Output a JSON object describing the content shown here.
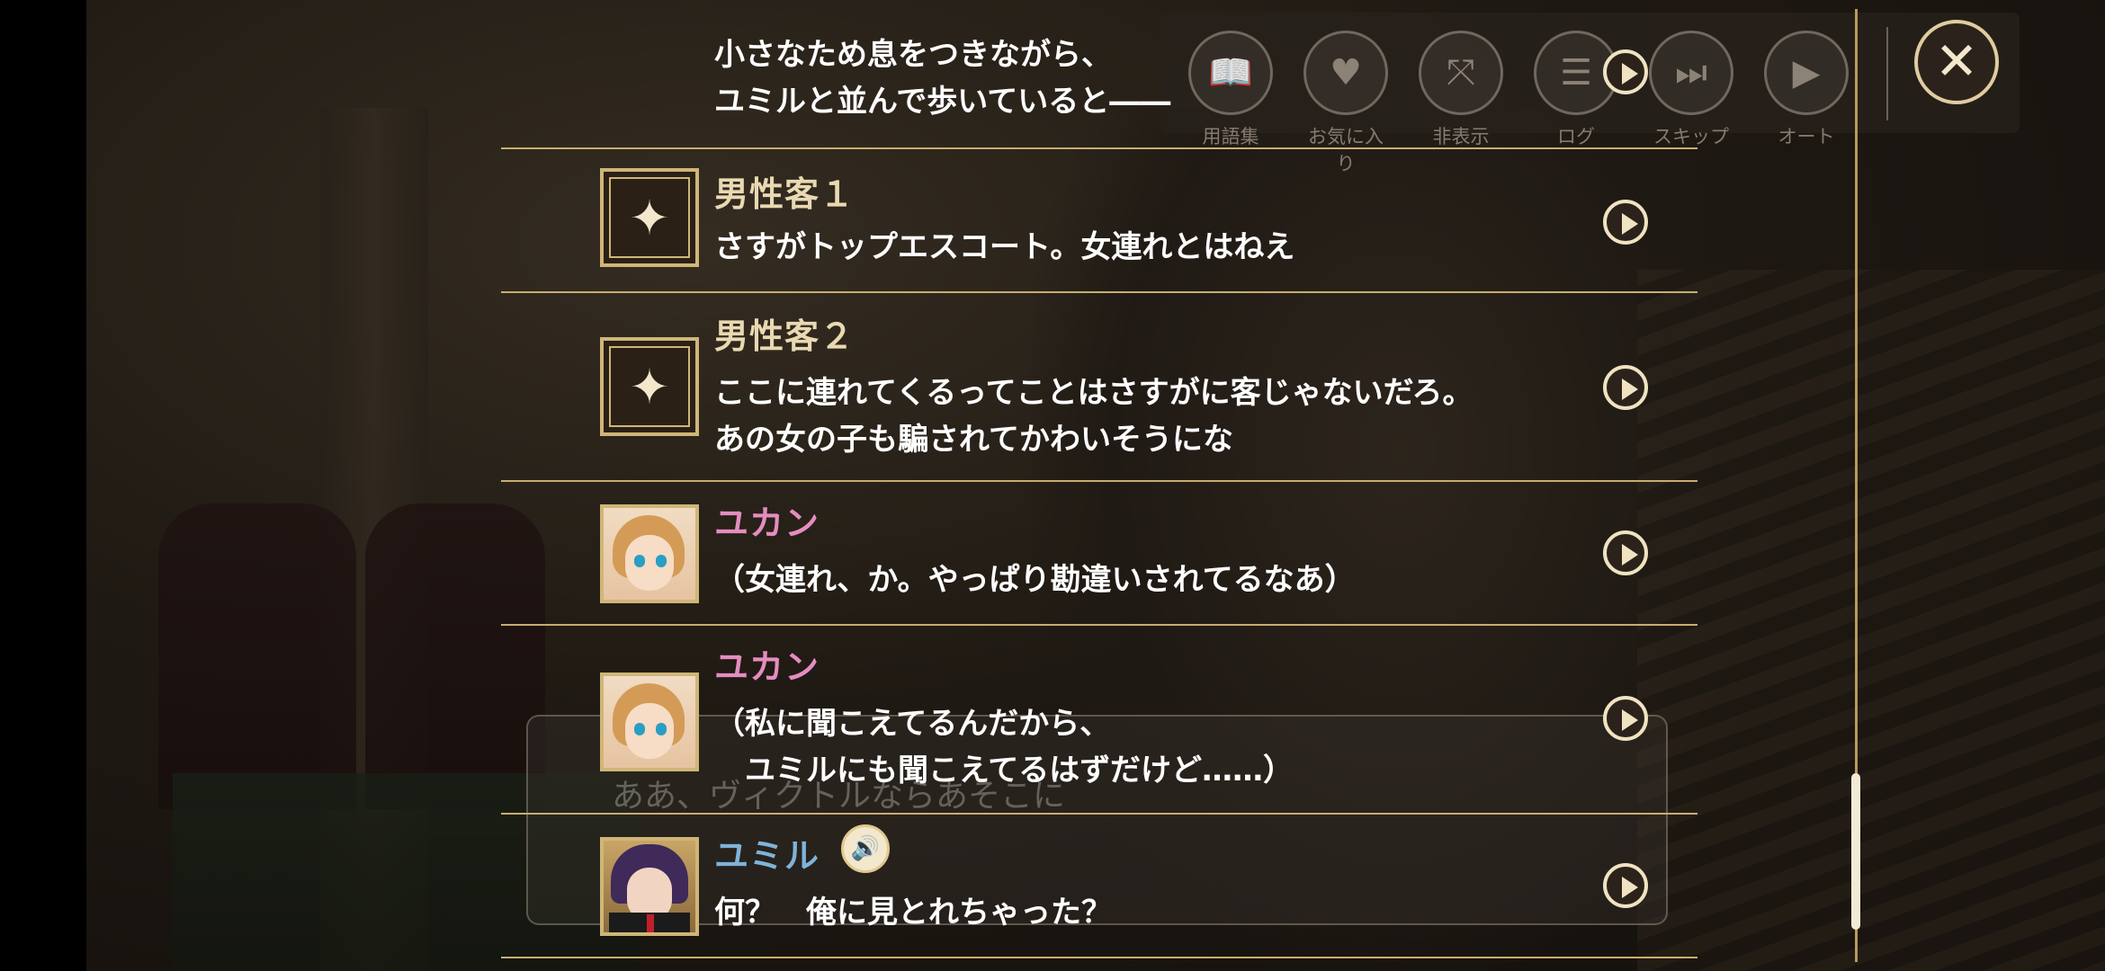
{
  "controls": {
    "glossary": {
      "label": "用語集",
      "icon": "book-icon"
    },
    "favorites": {
      "label": "お気に入り",
      "icon": "heart-icon"
    },
    "hide": {
      "label": "非表示",
      "icon": "hide-icon"
    },
    "log": {
      "label": "ログ",
      "icon": "log-icon"
    },
    "skip": {
      "label": "スキップ",
      "icon": "skip-icon"
    },
    "auto": {
      "label": "オート",
      "icon": "auto-icon"
    },
    "close_icon": "close-icon"
  },
  "background_text": "ああ、ヴィクトルならあそこに",
  "log": {
    "entries": [
      {
        "speaker": "",
        "text": "小さなため息をつきながら、\nユミルと並んで歩いていると――"
      },
      {
        "speaker": "男性客１",
        "avatar": "sparkle-icon",
        "text": "さすがトップエスコート。女連れとはねえ"
      },
      {
        "speaker": "男性客２",
        "avatar": "sparkle-icon",
        "text": "ここに連れてくるってことはさすがに客じゃないだろ。\nあの女の子も騙されてかわいそうにな"
      },
      {
        "speaker": "ユカン",
        "avatar": "yukan-portrait",
        "text": "（女連れ、か。やっぱり勘違いされてるなあ）"
      },
      {
        "speaker": "ユカン",
        "avatar": "yukan-portrait",
        "text": "（私に聞こえてるんだから、\n　ユミルにも聞こえてるはずだけど……）"
      },
      {
        "speaker": "ユミル",
        "avatar": "yumil-portrait",
        "voice": "speaker-icon",
        "text": "何？　俺に見とれちゃった？"
      }
    ]
  }
}
